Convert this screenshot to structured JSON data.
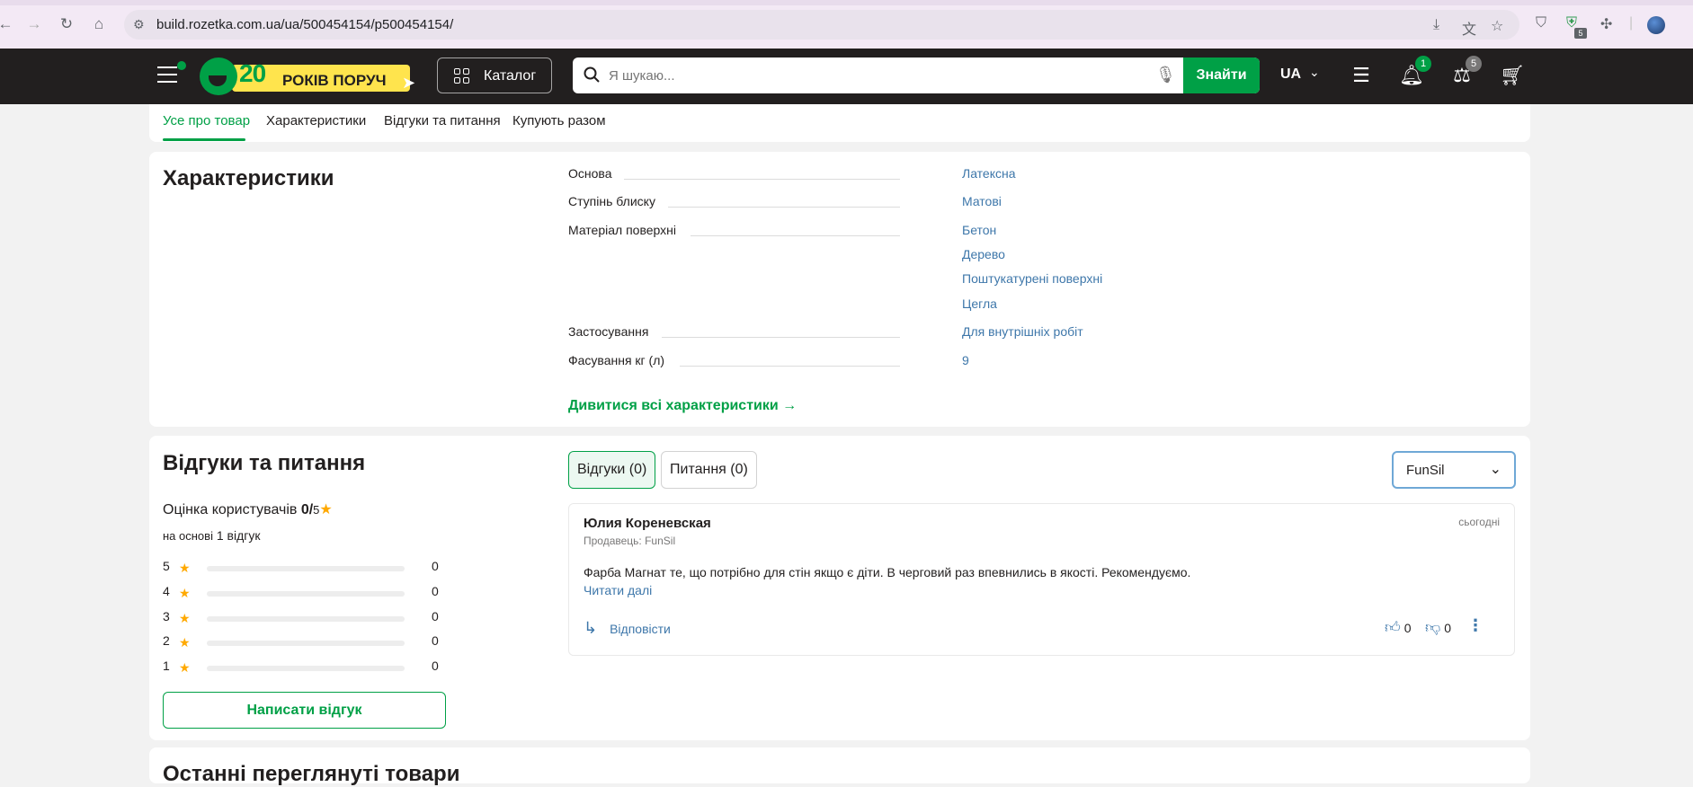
{
  "browser": {
    "url": "build.rozetka.com.ua/ua/500454154/p500454154/",
    "extension_badge": "5"
  },
  "header": {
    "logo_number": "20",
    "logo_text": "РОКІВ ПОРУЧ",
    "catalog_label": "Каталог",
    "search_placeholder": "Я шукаю...",
    "search_button": "Знайти",
    "language": "UA",
    "notifications_count": "1",
    "comparison_count": "5",
    "accent_color": "#00a046"
  },
  "tabs": [
    {
      "label": "Усе про товар",
      "active": true
    },
    {
      "label": "Характеристики",
      "active": false
    },
    {
      "label": "Відгуки та питання",
      "active": false
    },
    {
      "label": "Купують разом",
      "active": false
    }
  ],
  "characteristics": {
    "title": "Характеристики",
    "rows": [
      {
        "name": "Основа",
        "values": [
          "Латексна"
        ]
      },
      {
        "name": "Ступінь блиску",
        "values": [
          "Матові"
        ]
      },
      {
        "name": "Матеріал поверхні",
        "values": [
          "Бетон",
          "Дерево",
          "Поштукатурені поверхні",
          "Цегла"
        ]
      },
      {
        "name": "Застосування",
        "values": [
          "Для внутрішніх робіт"
        ]
      },
      {
        "name": "Фасування кг (л)",
        "values": [
          "9"
        ]
      }
    ],
    "all_link": "Дивитися всі характеристики →"
  },
  "reviews": {
    "title": "Відгуки та питання",
    "rating_label": "Оцінка користувачів",
    "rating_value": "0/",
    "rating_max": "5",
    "based_on_prefix": "на основі",
    "based_on_count": "1 відгук",
    "distribution": [
      {
        "stars": "5",
        "count": "0",
        "fraction": 0
      },
      {
        "stars": "4",
        "count": "0",
        "fraction": 0
      },
      {
        "stars": "3",
        "count": "0",
        "fraction": 0
      },
      {
        "stars": "2",
        "count": "0",
        "fraction": 0
      },
      {
        "stars": "1",
        "count": "0",
        "fraction": 0
      }
    ],
    "write_button": "Написати відгук",
    "tab_reviews": "Відгуки (0)",
    "tab_questions": "Питання (0)",
    "seller_filter": "FunSil",
    "item": {
      "author": "Юлия Кореневская",
      "seller": "Продавець: FunSil",
      "date": "сьогодні",
      "text": "Фарба Магнат те, що потрібно для стін якщо є діти. В черговий раз впевнились в якості. Рекомендуємо.",
      "read_more": "Читати далі",
      "reply": "Відповісти",
      "likes": "0",
      "dislikes": "0"
    }
  },
  "recently_viewed": {
    "title": "Останні переглянуті товари"
  }
}
